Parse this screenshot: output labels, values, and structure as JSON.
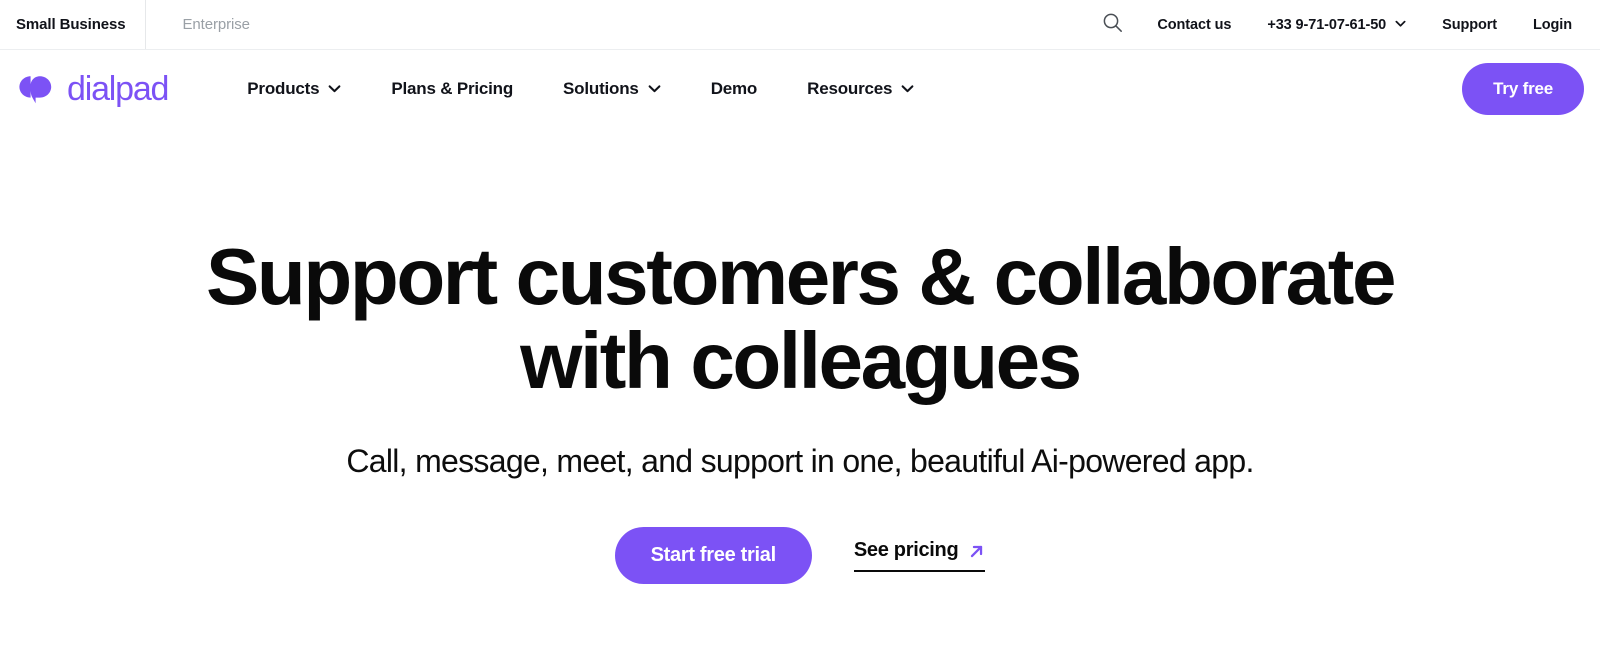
{
  "brand": {
    "name": "dialpad",
    "accent_color": "#7C52F5",
    "logo_icon": "dialpad-speech-bubbles-icon"
  },
  "utility_bar": {
    "tabs": [
      {
        "label": "Small Business",
        "active": true
      },
      {
        "label": "Enterprise",
        "active": false
      }
    ],
    "search_icon": "search-icon",
    "links": [
      {
        "label": "Contact us",
        "has_caret": false
      },
      {
        "label": "+33 9-71-07-61-50",
        "has_caret": true
      },
      {
        "label": "Support",
        "has_caret": false
      },
      {
        "label": "Login",
        "has_caret": false
      }
    ]
  },
  "main_nav": {
    "items": [
      {
        "label": "Products",
        "has_caret": true
      },
      {
        "label": "Plans & Pricing",
        "has_caret": false
      },
      {
        "label": "Solutions",
        "has_caret": true
      },
      {
        "label": "Demo",
        "has_caret": false
      },
      {
        "label": "Resources",
        "has_caret": true
      }
    ],
    "cta_label": "Try free"
  },
  "hero": {
    "title_line_1": "Support customers & collaborate",
    "title_line_2": "with colleagues",
    "subtitle": "Call, message, meet, and support in one, beautiful Ai-powered app.",
    "primary_cta": "Start free trial",
    "secondary_cta": "See pricing",
    "secondary_cta_icon": "arrow-up-right-icon"
  }
}
